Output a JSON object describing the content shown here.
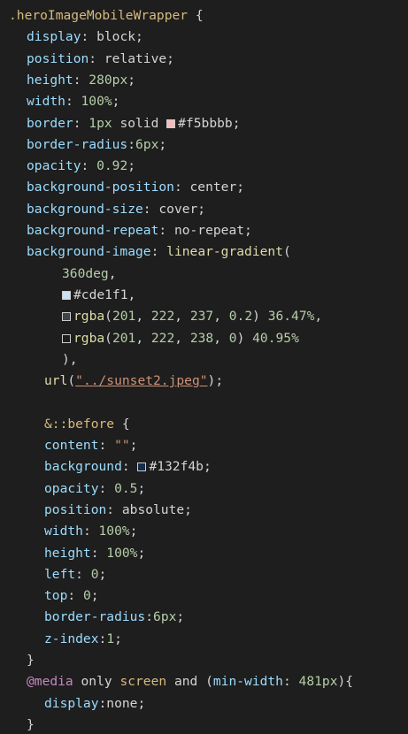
{
  "lines": [
    {
      "i": 0,
      "tokens": [
        {
          "t": ".heroImageMobileWrapper",
          "c": "sel"
        },
        {
          "t": " {",
          "c": "plain"
        }
      ]
    },
    {
      "i": 1,
      "tokens": [
        {
          "t": "display",
          "c": "prop"
        },
        {
          "t": ": block;",
          "c": "plain"
        }
      ]
    },
    {
      "i": 1,
      "tokens": [
        {
          "t": "position",
          "c": "prop"
        },
        {
          "t": ": relative;",
          "c": "plain"
        }
      ]
    },
    {
      "i": 1,
      "tokens": [
        {
          "t": "height",
          "c": "prop"
        },
        {
          "t": ": ",
          "c": "plain"
        },
        {
          "t": "280px",
          "c": "num"
        },
        {
          "t": ";",
          "c": "plain"
        }
      ]
    },
    {
      "i": 1,
      "tokens": [
        {
          "t": "width",
          "c": "prop"
        },
        {
          "t": ": ",
          "c": "plain"
        },
        {
          "t": "100%",
          "c": "num"
        },
        {
          "t": ";",
          "c": "plain"
        }
      ]
    },
    {
      "i": 1,
      "tokens": [
        {
          "t": "border",
          "c": "prop"
        },
        {
          "t": ": ",
          "c": "plain"
        },
        {
          "t": "1px",
          "c": "num"
        },
        {
          "t": " solid ",
          "c": "plain"
        },
        {
          "sw": "#f5bbbb"
        },
        {
          "t": "#f5bbbb",
          "c": "plain"
        },
        {
          "t": ";",
          "c": "plain"
        }
      ]
    },
    {
      "i": 1,
      "tokens": [
        {
          "t": "border-radius",
          "c": "prop"
        },
        {
          "t": ":",
          "c": "plain"
        },
        {
          "t": "6px",
          "c": "num"
        },
        {
          "t": ";",
          "c": "plain"
        }
      ]
    },
    {
      "i": 1,
      "tokens": [
        {
          "t": "opacity",
          "c": "prop"
        },
        {
          "t": ": ",
          "c": "plain"
        },
        {
          "t": "0.92",
          "c": "num"
        },
        {
          "t": ";",
          "c": "plain"
        }
      ]
    },
    {
      "i": 1,
      "tokens": [
        {
          "t": "background-position",
          "c": "prop"
        },
        {
          "t": ": center;",
          "c": "plain"
        }
      ]
    },
    {
      "i": 1,
      "tokens": [
        {
          "t": "background-size",
          "c": "prop"
        },
        {
          "t": ": cover;",
          "c": "plain"
        }
      ]
    },
    {
      "i": 1,
      "tokens": [
        {
          "t": "background-repeat",
          "c": "prop"
        },
        {
          "t": ": no-repeat;",
          "c": "plain"
        }
      ]
    },
    {
      "i": 1,
      "tokens": [
        {
          "t": "background-image",
          "c": "prop"
        },
        {
          "t": ": ",
          "c": "plain"
        },
        {
          "t": "linear-gradient",
          "c": "fn"
        },
        {
          "t": "(",
          "c": "plain"
        }
      ]
    },
    {
      "i": 3,
      "tokens": [
        {
          "t": "360deg",
          "c": "num"
        },
        {
          "t": ",",
          "c": "plain"
        }
      ]
    },
    {
      "i": 3,
      "tokens": [
        {
          "sw": "#cde1f1"
        },
        {
          "t": "#cde1f1",
          "c": "plain"
        },
        {
          "t": ",",
          "c": "plain"
        }
      ]
    },
    {
      "i": 3,
      "tokens": [
        {
          "sw": "rgba(201,222,237,0.2)"
        },
        {
          "t": "rgba",
          "c": "fn"
        },
        {
          "t": "(",
          "c": "plain"
        },
        {
          "t": "201",
          "c": "num"
        },
        {
          "t": ", ",
          "c": "plain"
        },
        {
          "t": "222",
          "c": "num"
        },
        {
          "t": ", ",
          "c": "plain"
        },
        {
          "t": "237",
          "c": "num"
        },
        {
          "t": ", ",
          "c": "plain"
        },
        {
          "t": "0.2",
          "c": "num"
        },
        {
          "t": ") ",
          "c": "plain"
        },
        {
          "t": "36.47%",
          "c": "num"
        },
        {
          "t": ",",
          "c": "plain"
        }
      ]
    },
    {
      "i": 3,
      "tokens": [
        {
          "sw": "rgba(201,222,238,0)"
        },
        {
          "t": "rgba",
          "c": "fn"
        },
        {
          "t": "(",
          "c": "plain"
        },
        {
          "t": "201",
          "c": "num"
        },
        {
          "t": ", ",
          "c": "plain"
        },
        {
          "t": "222",
          "c": "num"
        },
        {
          "t": ", ",
          "c": "plain"
        },
        {
          "t": "238",
          "c": "num"
        },
        {
          "t": ", ",
          "c": "plain"
        },
        {
          "t": "0",
          "c": "num"
        },
        {
          "t": ") ",
          "c": "plain"
        },
        {
          "t": "40.95%",
          "c": "num"
        }
      ]
    },
    {
      "i": 3,
      "tokens": [
        {
          "t": "),",
          "c": "plain"
        }
      ]
    },
    {
      "i": 2,
      "tokens": [
        {
          "t": "url",
          "c": "fn"
        },
        {
          "t": "(",
          "c": "plain"
        },
        {
          "t": "\"../sunset2.jpeg\"",
          "c": "url"
        },
        {
          "t": ");",
          "c": "plain"
        }
      ]
    },
    {
      "i": 0,
      "tokens": []
    },
    {
      "i": 2,
      "tokens": [
        {
          "t": "&::before",
          "c": "sel"
        },
        {
          "t": " {",
          "c": "plain"
        }
      ]
    },
    {
      "i": 2,
      "tokens": [
        {
          "t": "content",
          "c": "prop"
        },
        {
          "t": ": ",
          "c": "plain"
        },
        {
          "t": "\"\"",
          "c": "str"
        },
        {
          "t": ";",
          "c": "plain"
        }
      ]
    },
    {
      "i": 2,
      "tokens": [
        {
          "t": "background",
          "c": "prop"
        },
        {
          "t": ": ",
          "c": "plain"
        },
        {
          "sw": "#132f4b"
        },
        {
          "t": "#132f4b",
          "c": "plain"
        },
        {
          "t": ";",
          "c": "plain"
        }
      ]
    },
    {
      "i": 2,
      "tokens": [
        {
          "t": "opacity",
          "c": "prop"
        },
        {
          "t": ": ",
          "c": "plain"
        },
        {
          "t": "0.5",
          "c": "num"
        },
        {
          "t": ";",
          "c": "plain"
        }
      ]
    },
    {
      "i": 2,
      "tokens": [
        {
          "t": "position",
          "c": "prop"
        },
        {
          "t": ": absolute;",
          "c": "plain"
        }
      ]
    },
    {
      "i": 2,
      "tokens": [
        {
          "t": "width",
          "c": "prop"
        },
        {
          "t": ": ",
          "c": "plain"
        },
        {
          "t": "100%",
          "c": "num"
        },
        {
          "t": ";",
          "c": "plain"
        }
      ]
    },
    {
      "i": 2,
      "tokens": [
        {
          "t": "height",
          "c": "prop"
        },
        {
          "t": ": ",
          "c": "plain"
        },
        {
          "t": "100%",
          "c": "num"
        },
        {
          "t": ";",
          "c": "plain"
        }
      ]
    },
    {
      "i": 2,
      "tokens": [
        {
          "t": "left",
          "c": "prop"
        },
        {
          "t": ": ",
          "c": "plain"
        },
        {
          "t": "0",
          "c": "num"
        },
        {
          "t": ";",
          "c": "plain"
        }
      ]
    },
    {
      "i": 2,
      "tokens": [
        {
          "t": "top",
          "c": "prop"
        },
        {
          "t": ": ",
          "c": "plain"
        },
        {
          "t": "0",
          "c": "num"
        },
        {
          "t": ";",
          "c": "plain"
        }
      ]
    },
    {
      "i": 2,
      "tokens": [
        {
          "t": "border-radius",
          "c": "prop"
        },
        {
          "t": ":",
          "c": "plain"
        },
        {
          "t": "6px",
          "c": "num"
        },
        {
          "t": ";",
          "c": "plain"
        }
      ]
    },
    {
      "i": 2,
      "tokens": [
        {
          "t": "z-index",
          "c": "prop"
        },
        {
          "t": ":",
          "c": "plain"
        },
        {
          "t": "1",
          "c": "num"
        },
        {
          "t": ";",
          "c": "plain"
        }
      ]
    },
    {
      "i": 1,
      "tokens": [
        {
          "t": "}",
          "c": "plain"
        }
      ]
    },
    {
      "i": 1,
      "tokens": [
        {
          "t": "@media",
          "c": "at"
        },
        {
          "t": " only ",
          "c": "plain"
        },
        {
          "t": "screen",
          "c": "sel"
        },
        {
          "t": " and ",
          "c": "plain"
        },
        {
          "t": "(",
          "c": "plain"
        },
        {
          "t": "min-width",
          "c": "prop"
        },
        {
          "t": ": ",
          "c": "plain"
        },
        {
          "t": "481px",
          "c": "num"
        },
        {
          "t": "){",
          "c": "plain"
        }
      ]
    },
    {
      "i": 2,
      "tokens": [
        {
          "t": "display",
          "c": "prop"
        },
        {
          "t": ":none;",
          "c": "plain"
        }
      ]
    },
    {
      "i": 1,
      "tokens": [
        {
          "t": "}",
          "c": "plain"
        }
      ]
    }
  ]
}
